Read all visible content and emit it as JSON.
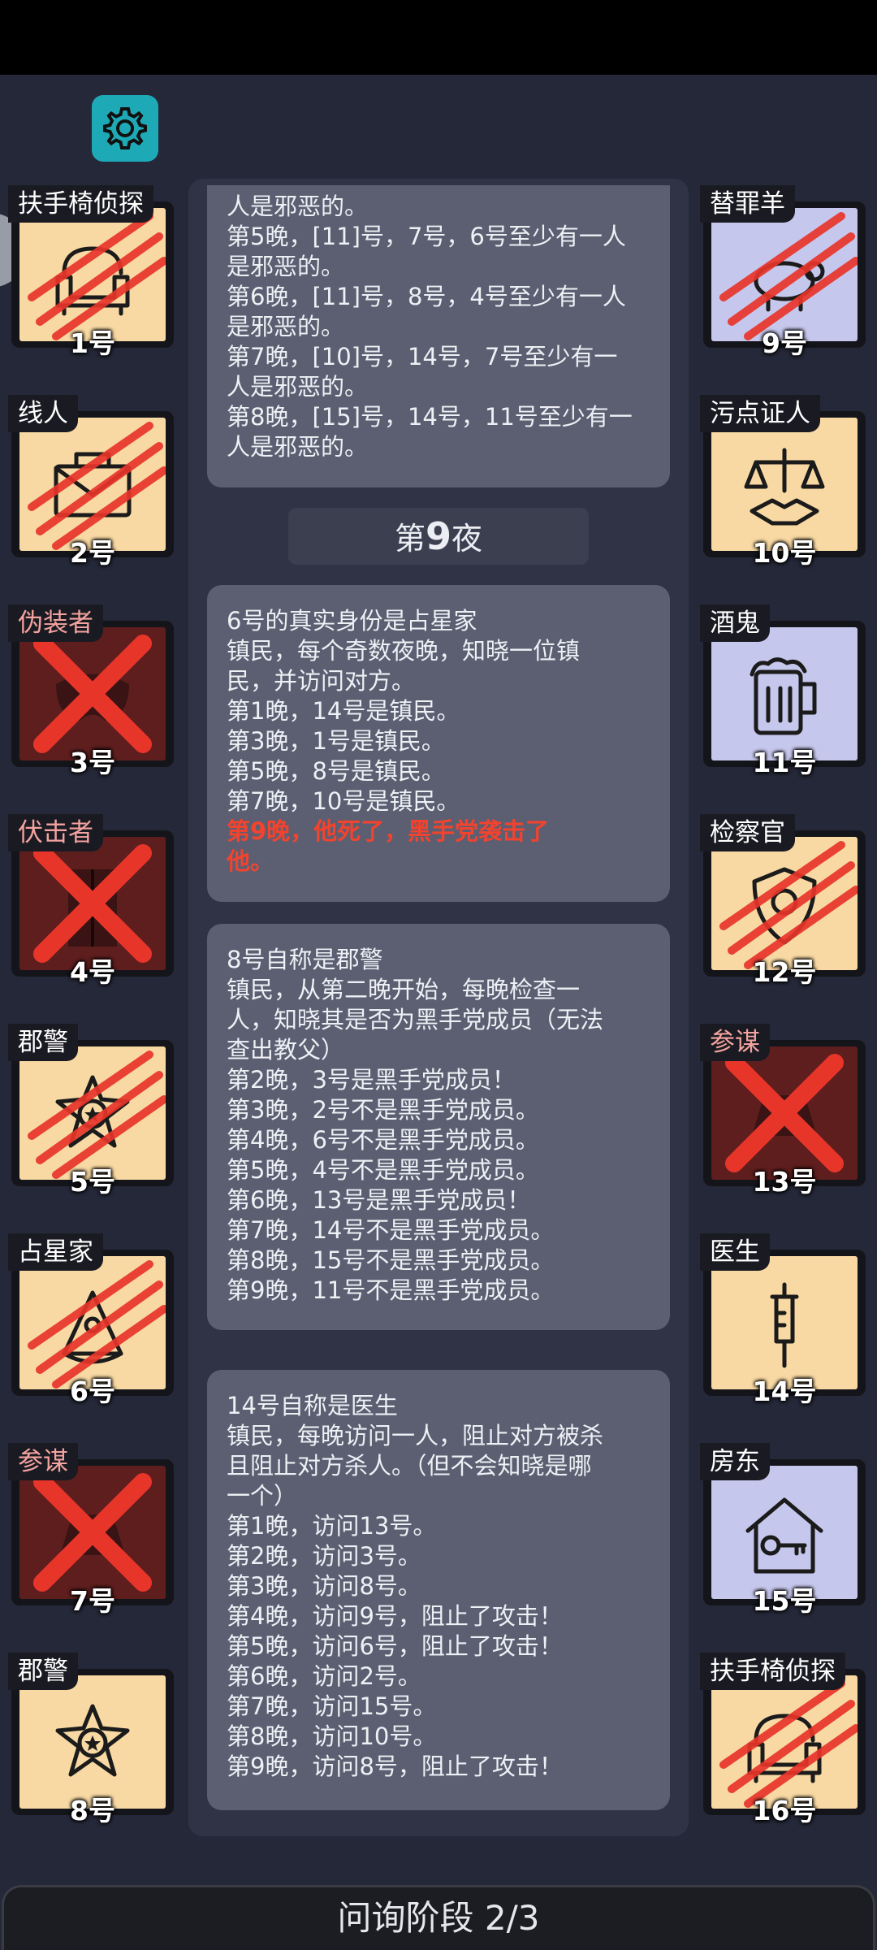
{
  "header": {
    "settings_icon": "gear-icon"
  },
  "colors": {
    "background": "#252838",
    "bubble": "#5b5f71",
    "good_card": "#f8d9a3",
    "outsider_card": "#c6c7ec",
    "evil_card": "#5e1e1e",
    "accent_gear": "#1ea9b7",
    "highlight_red": "#f2432f"
  },
  "left_players": [
    {
      "role": "扶手椅侦探",
      "number": "1号",
      "icon": "armchair-icon",
      "status": "claw",
      "team": "good"
    },
    {
      "role": "线人",
      "number": "2号",
      "icon": "envelope-icon",
      "status": "claw",
      "team": "good"
    },
    {
      "role": "伪装者",
      "number": "3号",
      "icon": "mask-icon",
      "status": "x",
      "team": "evil"
    },
    {
      "role": "伏击者",
      "number": "4号",
      "icon": "door-icon",
      "status": "x",
      "team": "evil"
    },
    {
      "role": "郡警",
      "number": "5号",
      "icon": "sheriff-badge-icon",
      "status": "claw",
      "team": "good"
    },
    {
      "role": "占星家",
      "number": "6号",
      "icon": "sextant-icon",
      "status": "claw",
      "team": "good"
    },
    {
      "role": "参谋",
      "number": "7号",
      "icon": "hat-icon",
      "status": "x",
      "team": "evil"
    },
    {
      "role": "郡警",
      "number": "8号",
      "icon": "sheriff-badge-icon",
      "status": "none",
      "team": "good"
    }
  ],
  "right_players": [
    {
      "role": "替罪羊",
      "number": "9号",
      "icon": "sheep-icon",
      "status": "claw",
      "team": "outsider"
    },
    {
      "role": "污点证人",
      "number": "10号",
      "icon": "scales-handshake-icon",
      "status": "none",
      "team": "good"
    },
    {
      "role": "酒鬼",
      "number": "11号",
      "icon": "beer-mug-icon",
      "status": "none",
      "team": "outsider"
    },
    {
      "role": "检察官",
      "number": "12号",
      "icon": "prosecutor-badge-icon",
      "status": "claw",
      "team": "good"
    },
    {
      "role": "参谋",
      "number": "13号",
      "icon": "hat-icon",
      "status": "x",
      "team": "evil"
    },
    {
      "role": "医生",
      "number": "14号",
      "icon": "syringe-icon",
      "status": "none",
      "team": "good"
    },
    {
      "role": "房东",
      "number": "15号",
      "icon": "house-key-icon",
      "status": "none",
      "team": "outsider"
    },
    {
      "role": "扶手椅侦探",
      "number": "16号",
      "icon": "armchair-icon",
      "status": "claw",
      "team": "good"
    }
  ],
  "log": {
    "top_bubble": [
      "人是邪恶的。",
      "第5晚，[11]号，7号，6号至少有一人",
      "是邪恶的。",
      "第6晚，[11]号，8号，4号至少有一人",
      "是邪恶的。",
      "第7晚，[10]号，14号，7号至少有一",
      "人是邪恶的。",
      "第8晚，[15]号，14号，11号至少有一",
      "人是邪恶的。"
    ],
    "night_label_prefix": "第",
    "night_number": "9",
    "night_label_suffix": "夜",
    "bubble2": {
      "lines": [
        "6号的真实身份是占星家",
        "镇民，每个奇数夜晚，知晓一位镇",
        "民，并访问对方。",
        "第1晚，14号是镇民。",
        "第3晚，1号是镇民。",
        "第5晚，8号是镇民。",
        "第7晚，10号是镇民。"
      ],
      "highlight": [
        "第9晚，他死了，黑手党袭击了",
        "他。"
      ]
    },
    "bubble3": [
      "8号自称是郡警",
      "镇民，从第二晚开始，每晚检查一",
      "人，知晓其是否为黑手党成员（无法",
      "查出教父）",
      "第2晚，3号是黑手党成员！",
      "第3晚，2号不是黑手党成员。",
      "第4晚，6号不是黑手党成员。",
      "第5晚，4号不是黑手党成员。",
      "第6晚，13号是黑手党成员！",
      "第7晚，14号不是黑手党成员。",
      "第8晚，15号不是黑手党成员。",
      "第9晚，11号不是黑手党成员。"
    ],
    "bubble4": [
      "14号自称是医生",
      "镇民，每晚访问一人，阻止对方被杀",
      "且阻止对方杀人。（但不会知晓是哪",
      "一个）",
      "第1晚，访问13号。",
      "第2晚，访问3号。",
      "第3晚，访问8号。",
      "第4晚，访问9号，阻止了攻击！",
      "第5晚，访问6号，阻止了攻击！",
      "第6晚，访问2号。",
      "第7晚，访问15号。",
      "第8晚，访问10号。",
      "第9晚，访问8号，阻止了攻击！"
    ]
  },
  "footer": {
    "phase": "问询阶段 2/3"
  }
}
